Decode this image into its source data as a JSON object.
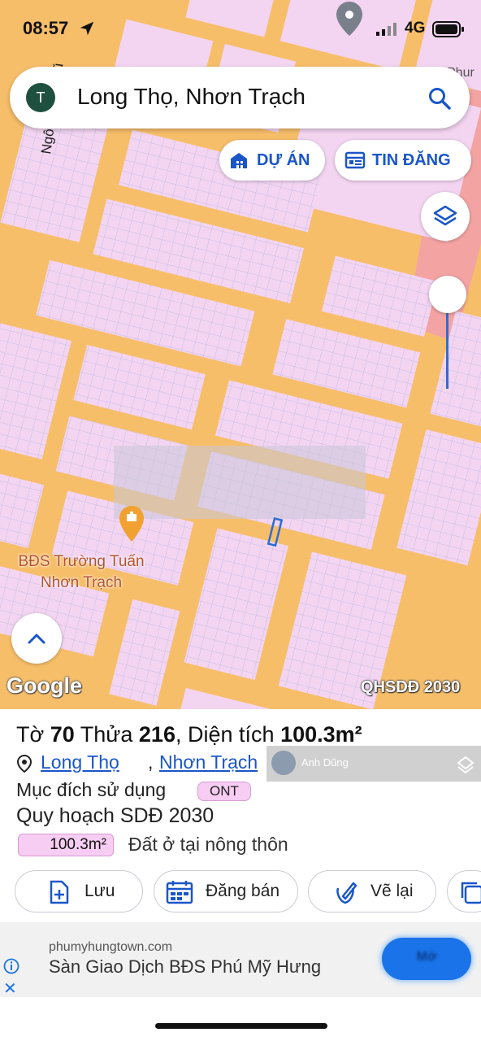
{
  "status_bar": {
    "time": "08:57",
    "network": "4G"
  },
  "map": {
    "road_label": "Ngô Quyền Cũ",
    "corner_label": "Phur",
    "search": {
      "avatar_letter": "T",
      "query": "Long Thọ, Nhơn Trạch"
    },
    "chips": {
      "project_label": "DỰ ÁN",
      "listing_label": "TIN ĐĂNG"
    },
    "place": {
      "name": "BĐS Trường Tuấn Nhơn Trạch"
    },
    "google_logo": "Google",
    "plan_tag": "QHSDĐ 2030",
    "colors": {
      "road": "#f7be6a",
      "residential": "#f3d5f1",
      "commercial": "#f4a3a3",
      "accent": "#1a56c8"
    }
  },
  "parcel": {
    "prefix": "Tờ",
    "sheet": "70",
    "plot_label": "Thửa",
    "plot": "216",
    "area_label": "Diện tích",
    "area": "100.3m²",
    "ward": "Long Thọ",
    "district": "Nhơn Trạch",
    "separator": ",",
    "purpose_label": "Mục đích sử dụng",
    "purpose_code": "ONT",
    "plan_label": "Quy hoạch SDĐ 2030",
    "plan_area": "100.3m²",
    "land_type": "Đất ở tại nông thôn"
  },
  "watermark": {
    "name": "Anh Dũng"
  },
  "actions": {
    "save": "Lưu",
    "sell": "Đăng bán",
    "redraw": "Vẽ lại"
  },
  "ad": {
    "domain": "phumyhungtown.com",
    "title": "Sàn Giao Dịch BĐS Phú Mỹ Hưng",
    "cta": "Mở"
  }
}
